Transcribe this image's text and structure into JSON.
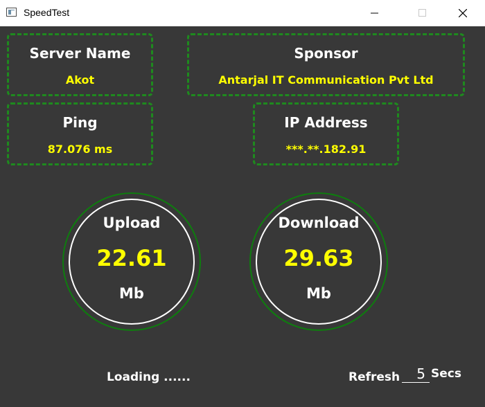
{
  "window": {
    "title": "SpeedTest",
    "icon": "app-window-icon",
    "controls": [
      "minimize-icon",
      "maximize-icon",
      "close-icon"
    ]
  },
  "server": {
    "label": "Server Name",
    "value": "Akot"
  },
  "sponsor": {
    "label": "Sponsor",
    "value": "Antarjal IT Communication Pvt Ltd"
  },
  "ping": {
    "label": "Ping",
    "value": "87.076 ms"
  },
  "ip": {
    "label": "IP Address",
    "value": "***.**.182.91"
  },
  "upload": {
    "label": "Upload",
    "value": "22.61",
    "unit": "Mb"
  },
  "download": {
    "label": "Download",
    "value": "29.63",
    "unit": "Mb"
  },
  "status": {
    "text": "Loading ......"
  },
  "refresh": {
    "label": "Refresh",
    "value": "5",
    "unit": "Secs"
  },
  "colors": {
    "background": "#383838",
    "accent_green": "#1e8a1e",
    "value_yellow": "#ffff00",
    "text_white": "#ffffff"
  }
}
